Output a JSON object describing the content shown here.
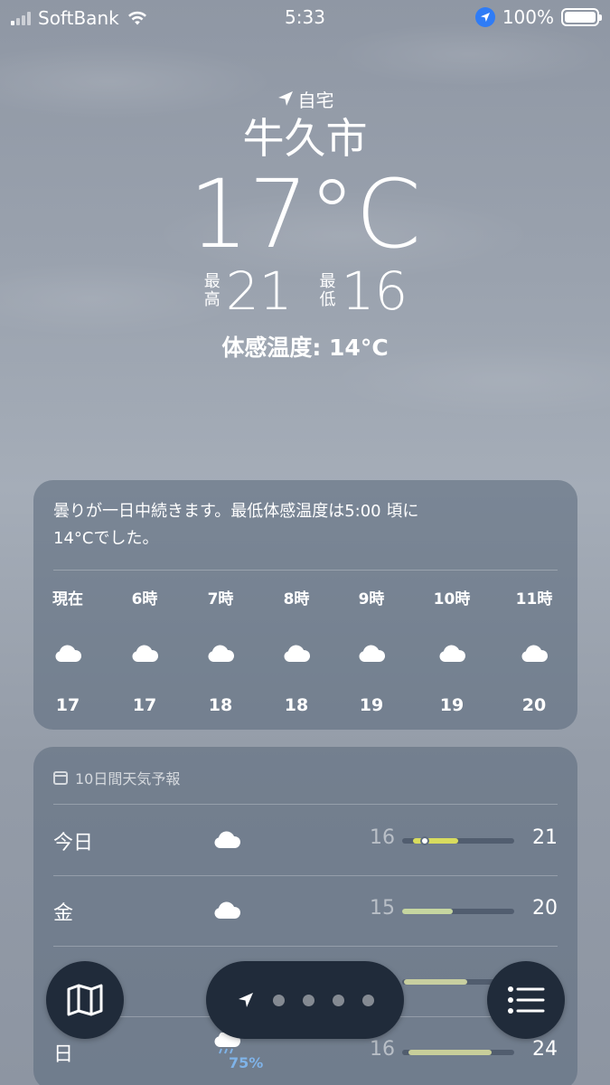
{
  "status": {
    "carrier": "SoftBank",
    "time": "5:33",
    "battery": "100%"
  },
  "location": {
    "label": "自宅",
    "city": "牛久市",
    "temperature": "17°C",
    "high_label": "最高",
    "high": "21",
    "low_label": "最低",
    "low": "16",
    "feels_like": "体感温度: 14°C"
  },
  "hourly": {
    "summary_line1": "曇りが一日中続きます。最低体感温度は5:00 頃に",
    "summary_line2": "14°Cでした。",
    "hours": [
      {
        "label": "現在",
        "icon": "cloud-icon",
        "temp": "17"
      },
      {
        "label": "6時",
        "icon": "cloud-icon",
        "temp": "17"
      },
      {
        "label": "7時",
        "icon": "cloud-icon",
        "temp": "18"
      },
      {
        "label": "8時",
        "icon": "cloud-icon",
        "temp": "18"
      },
      {
        "label": "9時",
        "icon": "cloud-icon",
        "temp": "19"
      },
      {
        "label": "10時",
        "icon": "cloud-icon",
        "temp": "19"
      },
      {
        "label": "11時",
        "icon": "cloud-icon",
        "temp": "20"
      }
    ]
  },
  "forecast": {
    "title": "10日間天気予報",
    "days": [
      {
        "day": "今日",
        "icon": "cloud-icon",
        "low": "16",
        "high": "21",
        "bar_start": 0.1,
        "bar_end": 0.5,
        "current": 0.2,
        "color": "#d8dc5e"
      },
      {
        "day": "金",
        "icon": "cloud-icon",
        "low": "15",
        "high": "20",
        "bar_start": 0.0,
        "bar_end": 0.45,
        "color": "#c6d6a0"
      },
      {
        "day": "",
        "icon": "cloud-sun-icon",
        "low": "",
        "high": "",
        "bar_start": 0.02,
        "bar_end": 0.58,
        "color": "#c8cfa0"
      },
      {
        "day": "日",
        "icon": "cloud-rain-icon",
        "precip": "75%",
        "low": "16",
        "high": "24",
        "bar_start": 0.06,
        "bar_end": 0.8,
        "color": "#c8ce9a"
      }
    ]
  },
  "colors": {
    "card_bg": "#606e80",
    "button_bg": "#202b3a",
    "location_blue": "#2f7cf6"
  },
  "icons": {
    "map": "map-icon",
    "location": "location-arrow-icon",
    "list": "list-icon"
  }
}
